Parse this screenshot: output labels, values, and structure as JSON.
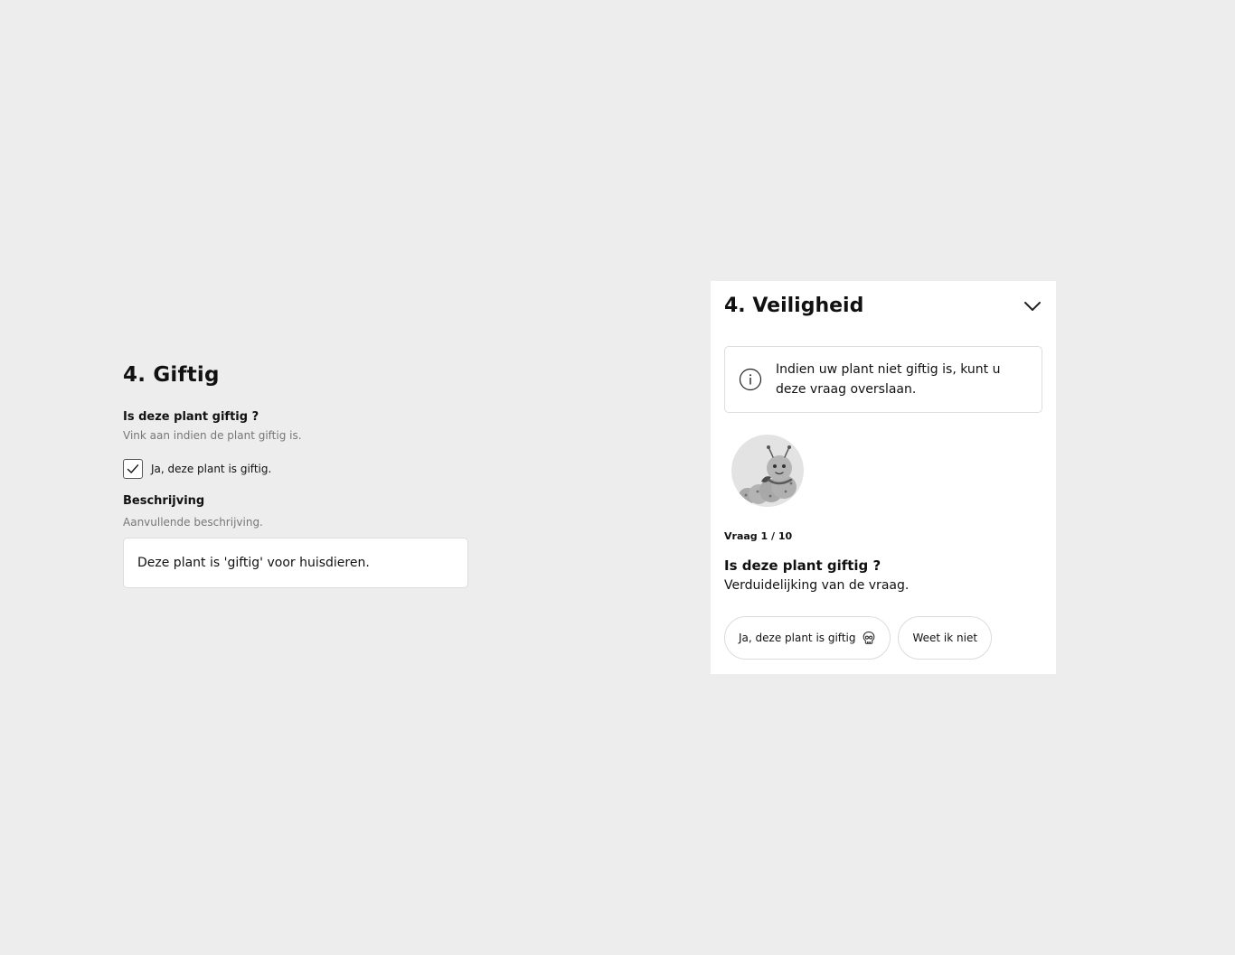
{
  "giftig_form": {
    "title": "4. Giftig",
    "question_label": "Is deze plant giftig ?",
    "question_help": "Vink aan indien de plant giftig is.",
    "checkbox_label": "Ja, deze plant is giftig.",
    "checkbox_checked": true,
    "description_label": "Beschrijving",
    "description_help": "Aanvullende beschrijving.",
    "description_value": "Deze plant is 'giftig' voor huisdieren."
  },
  "veiligheid_panel": {
    "title": "4. Veiligheid",
    "toggle_icon": "chevron-down-icon",
    "info_icon": "info-icon",
    "info_text": "Indien uw plant niet giftig is, kunt u deze vraag overslaan.",
    "avatar": "caterpillar-mascot",
    "counter": "Vraag 1 / 10",
    "question": "Is deze plant giftig ?",
    "clarification": "Verduidelijking van de vraag.",
    "answers": [
      {
        "label": "Ja, deze plant is giftig",
        "icon": "skull-icon"
      },
      {
        "label": "Weet ik niet"
      }
    ]
  }
}
